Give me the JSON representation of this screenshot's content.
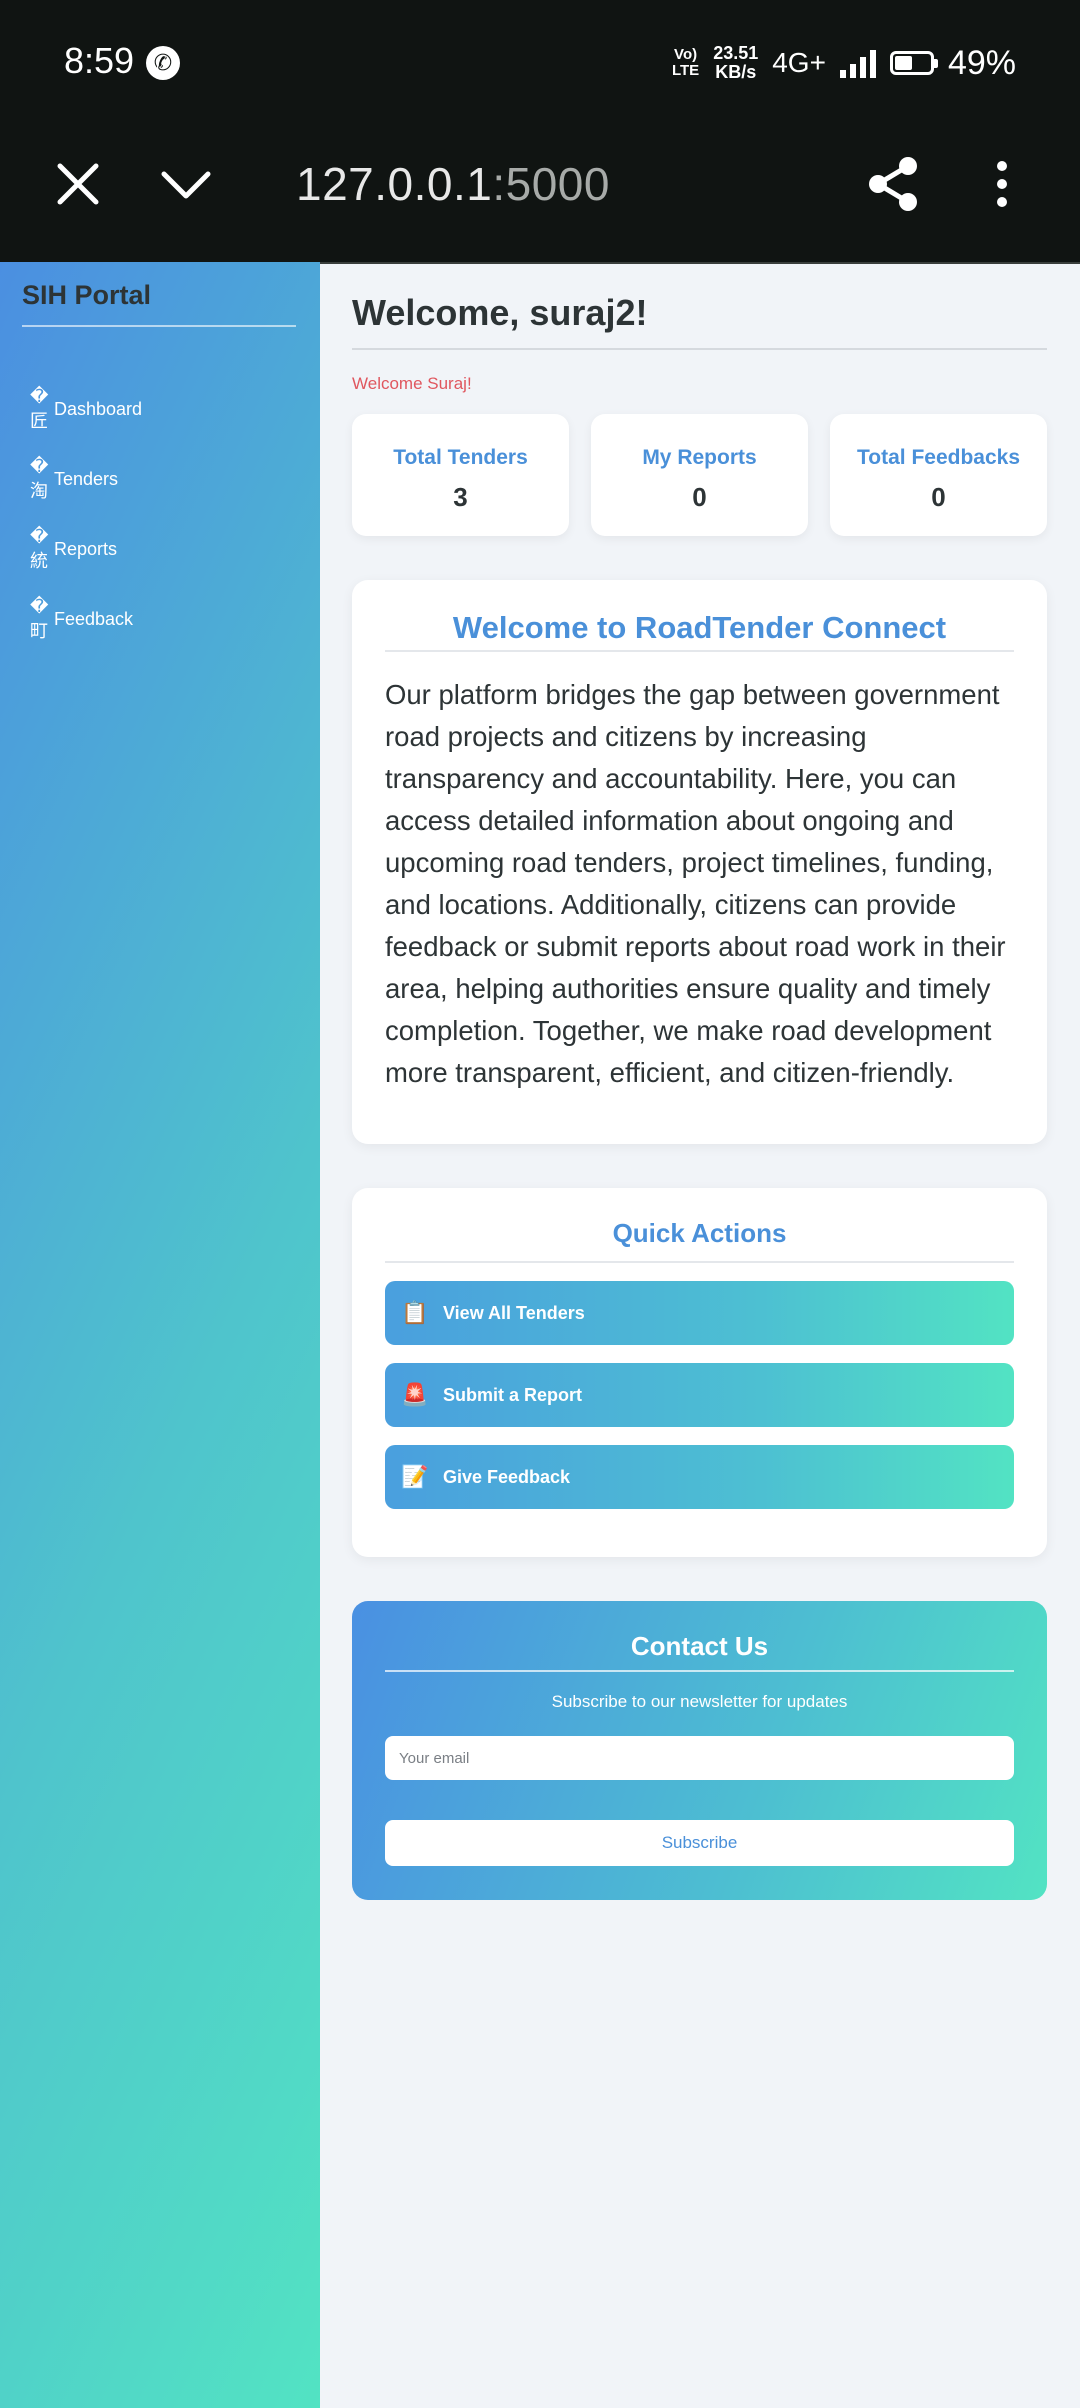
{
  "status_bar": {
    "time": "8:59",
    "call_icon": "wifi-call-icon",
    "volte_label": "Vo) LTE",
    "network_speed": "23.51 KB/s",
    "network_type": "4G+",
    "battery_level": 0.49,
    "battery_text": "49%"
  },
  "browser": {
    "url_host": "127.0.0.1",
    "url_port": ":5000",
    "icons": [
      "close-icon",
      "chevron-down-icon",
      "share-icon",
      "more-vert-icon"
    ]
  },
  "sidebar": {
    "title": "SIH Portal",
    "items": [
      {
        "icon": "�匠",
        "label": "Dashboard"
      },
      {
        "icon": "�淘",
        "label": "Tenders"
      },
      {
        "icon": "�統",
        "label": "Reports"
      },
      {
        "icon": "�町",
        "label": "Feedback"
      }
    ]
  },
  "main": {
    "title": "Welcome, suraj2!",
    "flash_message": "Welcome Suraj!",
    "stats": [
      {
        "label": "Total Tenders",
        "value": "3"
      },
      {
        "label": "My Reports",
        "value": "0"
      },
      {
        "label": "Total Feedbacks",
        "value": "0"
      }
    ],
    "intro": {
      "title": "Welcome to RoadTender Connect",
      "body": "Our platform bridges the gap between government road projects and citizens by increasing transparency and accountability. Here, you can access detailed information about ongoing and upcoming road tenders, project timelines, funding, and locations. Additionally, citizens can provide feedback or submit reports about road work in their area, helping authorities ensure quality and timely completion. Together, we make road development more transparent, efficient, and citizen-friendly."
    },
    "quick_actions": {
      "title": "Quick Actions",
      "buttons": [
        {
          "emoji": "📋",
          "label": "View All Tenders"
        },
        {
          "emoji": "🚨",
          "label": "Submit a Report"
        },
        {
          "emoji": "📝",
          "label": "Give Feedback"
        }
      ]
    },
    "contact": {
      "title": "Contact Us",
      "subtitle": "Subscribe to our newsletter for updates",
      "email_placeholder": "Your email",
      "email_value": "",
      "subscribe_label": "Subscribe"
    }
  },
  "colors": {
    "accent": "#4a90d9",
    "gradient_start": "#4a90e2",
    "gradient_end": "#52e3c3",
    "flash": "#e0575f",
    "browser_bg": "#101412"
  }
}
